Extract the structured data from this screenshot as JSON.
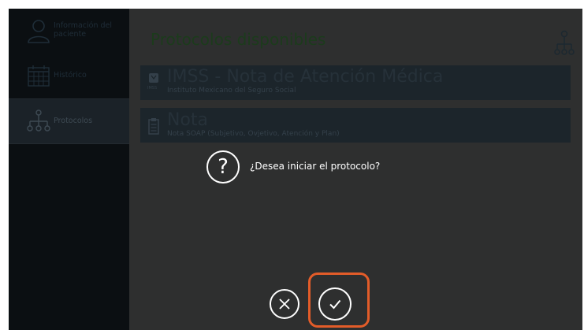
{
  "sidebar": {
    "items": [
      {
        "label": "Información del paciente",
        "icon": "user-icon",
        "active": false
      },
      {
        "label": "Histórico",
        "icon": "calendar-icon",
        "active": false
      },
      {
        "label": "Protocolos",
        "icon": "hierarchy-icon",
        "active": true
      }
    ]
  },
  "main": {
    "title": "Protocolos disponibles",
    "header_icon": "hierarchy-icon",
    "protocols": [
      {
        "title": "IMSS - Nota de Atención Médica",
        "subtitle": "Instituto Mexicano del Seguro Social",
        "icon": "imss-logo-icon",
        "icon_caption": "IMSS"
      },
      {
        "title": "Nota",
        "subtitle": "Nota SOAP (Subjetivo, Ovjetivo, Atención y Plan)",
        "icon": "clipboard-icon"
      }
    ]
  },
  "dialog": {
    "question_glyph": "?",
    "message": "¿Desea iniciar el protocolo?",
    "cancel_icon": "close-icon",
    "confirm_icon": "check-icon"
  },
  "colors": {
    "highlight": "#e35c29",
    "overlay": "#2e2f2f",
    "sidebar_bg": "#0b0f12"
  }
}
